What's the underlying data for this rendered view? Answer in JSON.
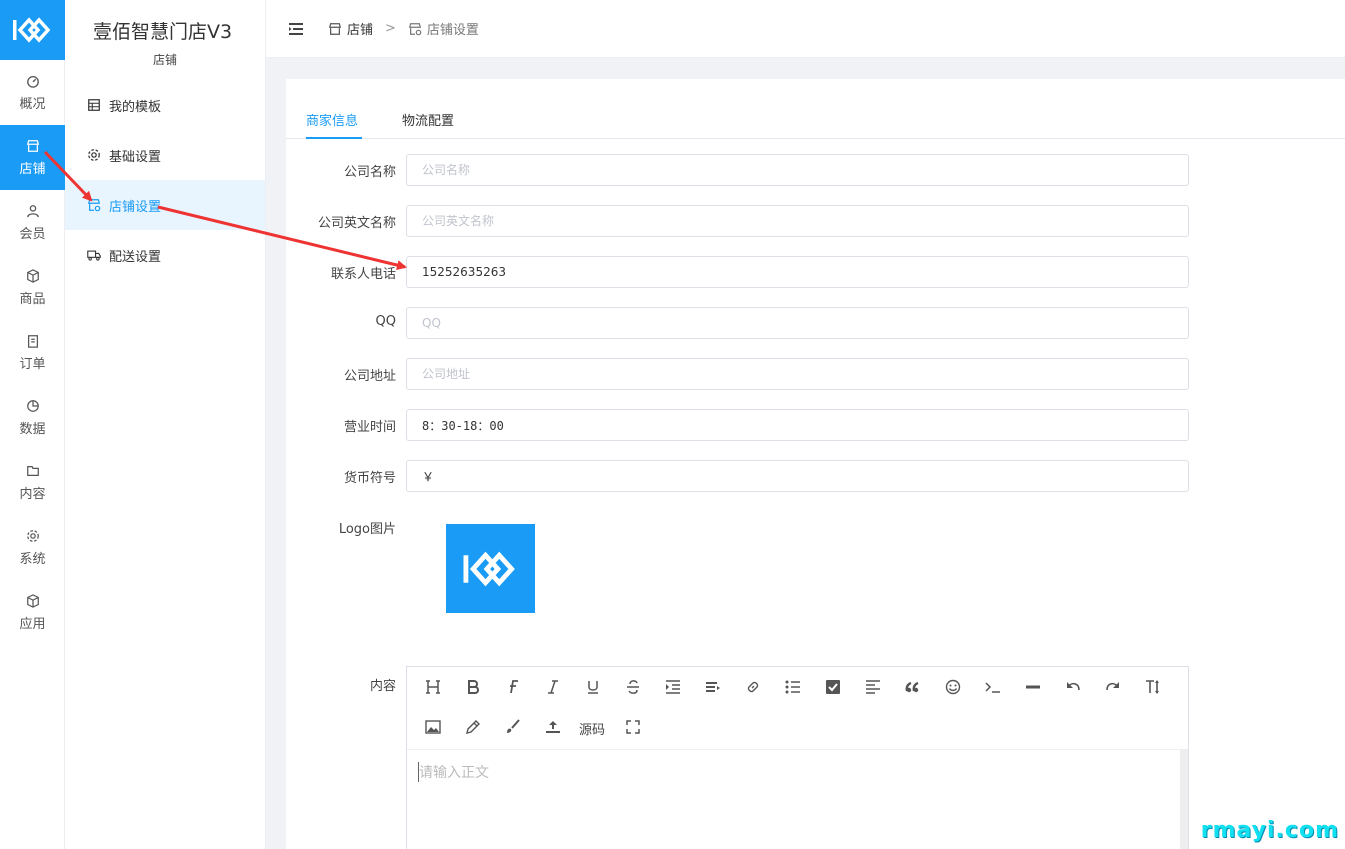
{
  "app": {
    "title": "壹佰智慧门店V3",
    "section": "店铺",
    "brand_color": "#1a9bf5"
  },
  "rail": {
    "items": [
      {
        "label": "概况",
        "icon": "dashboard-icon"
      },
      {
        "label": "店铺",
        "icon": "store-icon",
        "active": true
      },
      {
        "label": "会员",
        "icon": "user-icon"
      },
      {
        "label": "商品",
        "icon": "box-icon"
      },
      {
        "label": "订单",
        "icon": "clipboard-icon"
      },
      {
        "label": "数据",
        "icon": "pie-chart-icon"
      },
      {
        "label": "内容",
        "icon": "folder-icon"
      },
      {
        "label": "系统",
        "icon": "gear-icon"
      },
      {
        "label": "应用",
        "icon": "cube-icon"
      }
    ]
  },
  "submenu": {
    "items": [
      {
        "label": "我的模板",
        "icon": "template-icon"
      },
      {
        "label": "基础设置",
        "icon": "gear-icon"
      },
      {
        "label": "店铺设置",
        "icon": "store-settings-icon",
        "active": true
      },
      {
        "label": "配送设置",
        "icon": "truck-icon"
      }
    ]
  },
  "breadcrumb": {
    "root": "店铺",
    "separator": ">",
    "current": "店铺设置"
  },
  "tabs": [
    {
      "label": "商家信息",
      "active": true
    },
    {
      "label": "物流配置"
    }
  ],
  "form": {
    "company_name": {
      "label": "公司名称",
      "value": "",
      "placeholder": "公司名称"
    },
    "company_en_name": {
      "label": "公司英文名称",
      "value": "",
      "placeholder": "公司英文名称"
    },
    "contact_phone": {
      "label": "联系人电话",
      "value": "15252635263",
      "placeholder": ""
    },
    "qq": {
      "label": "QQ",
      "value": "",
      "placeholder": "QQ"
    },
    "address": {
      "label": "公司地址",
      "value": "",
      "placeholder": "公司地址"
    },
    "business_hours": {
      "label": "营业时间",
      "value": "8：30-18：00",
      "placeholder": ""
    },
    "currency": {
      "label": "货币符号",
      "value": "￥",
      "placeholder": ""
    },
    "logo": {
      "label": "Logo图片"
    },
    "content": {
      "label": "内容",
      "placeholder": "请输入正文",
      "toolbar": [
        "heading-icon",
        "bold-icon",
        "font-icon",
        "italic-icon",
        "underline-icon",
        "strikethrough-icon",
        "indent-icon",
        "line-height-icon",
        "link-icon",
        "bullet-list-icon",
        "checkbox-icon",
        "align-left-icon",
        "quote-icon",
        "emoji-icon",
        "code-icon",
        "horizontal-rule-icon",
        "undo-icon",
        "redo-icon",
        "font-size-icon",
        "image-icon",
        "pen-icon",
        "brush-icon",
        "upload-icon",
        "fullscreen-icon"
      ],
      "source_label": "源码"
    }
  },
  "annotation_color": "#ee3333",
  "watermark": "rmayi.com"
}
